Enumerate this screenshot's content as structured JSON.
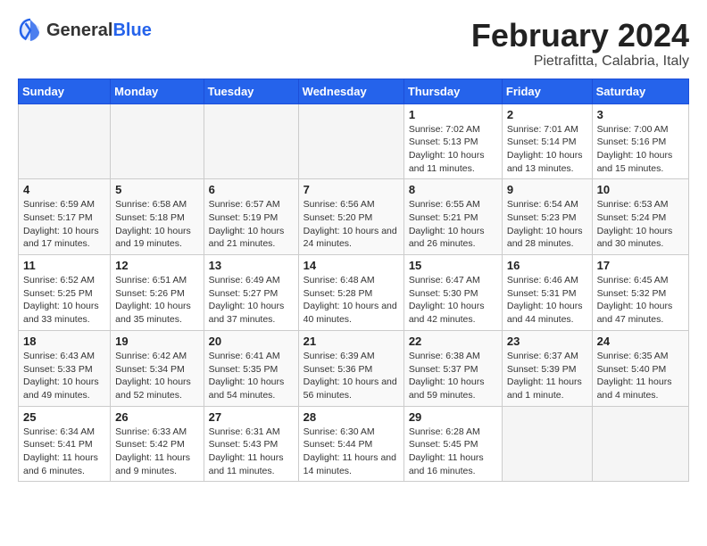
{
  "header": {
    "logo_general": "General",
    "logo_blue": "Blue",
    "main_title": "February 2024",
    "subtitle": "Pietrafitta, Calabria, Italy"
  },
  "calendar": {
    "days_of_week": [
      "Sunday",
      "Monday",
      "Tuesday",
      "Wednesday",
      "Thursday",
      "Friday",
      "Saturday"
    ],
    "weeks": [
      [
        {
          "day": "",
          "info": ""
        },
        {
          "day": "",
          "info": ""
        },
        {
          "day": "",
          "info": ""
        },
        {
          "day": "",
          "info": ""
        },
        {
          "day": "1",
          "info": "Sunrise: 7:02 AM\nSunset: 5:13 PM\nDaylight: 10 hours and 11 minutes."
        },
        {
          "day": "2",
          "info": "Sunrise: 7:01 AM\nSunset: 5:14 PM\nDaylight: 10 hours and 13 minutes."
        },
        {
          "day": "3",
          "info": "Sunrise: 7:00 AM\nSunset: 5:16 PM\nDaylight: 10 hours and 15 minutes."
        }
      ],
      [
        {
          "day": "4",
          "info": "Sunrise: 6:59 AM\nSunset: 5:17 PM\nDaylight: 10 hours and 17 minutes."
        },
        {
          "day": "5",
          "info": "Sunrise: 6:58 AM\nSunset: 5:18 PM\nDaylight: 10 hours and 19 minutes."
        },
        {
          "day": "6",
          "info": "Sunrise: 6:57 AM\nSunset: 5:19 PM\nDaylight: 10 hours and 21 minutes."
        },
        {
          "day": "7",
          "info": "Sunrise: 6:56 AM\nSunset: 5:20 PM\nDaylight: 10 hours and 24 minutes."
        },
        {
          "day": "8",
          "info": "Sunrise: 6:55 AM\nSunset: 5:21 PM\nDaylight: 10 hours and 26 minutes."
        },
        {
          "day": "9",
          "info": "Sunrise: 6:54 AM\nSunset: 5:23 PM\nDaylight: 10 hours and 28 minutes."
        },
        {
          "day": "10",
          "info": "Sunrise: 6:53 AM\nSunset: 5:24 PM\nDaylight: 10 hours and 30 minutes."
        }
      ],
      [
        {
          "day": "11",
          "info": "Sunrise: 6:52 AM\nSunset: 5:25 PM\nDaylight: 10 hours and 33 minutes."
        },
        {
          "day": "12",
          "info": "Sunrise: 6:51 AM\nSunset: 5:26 PM\nDaylight: 10 hours and 35 minutes."
        },
        {
          "day": "13",
          "info": "Sunrise: 6:49 AM\nSunset: 5:27 PM\nDaylight: 10 hours and 37 minutes."
        },
        {
          "day": "14",
          "info": "Sunrise: 6:48 AM\nSunset: 5:28 PM\nDaylight: 10 hours and 40 minutes."
        },
        {
          "day": "15",
          "info": "Sunrise: 6:47 AM\nSunset: 5:30 PM\nDaylight: 10 hours and 42 minutes."
        },
        {
          "day": "16",
          "info": "Sunrise: 6:46 AM\nSunset: 5:31 PM\nDaylight: 10 hours and 44 minutes."
        },
        {
          "day": "17",
          "info": "Sunrise: 6:45 AM\nSunset: 5:32 PM\nDaylight: 10 hours and 47 minutes."
        }
      ],
      [
        {
          "day": "18",
          "info": "Sunrise: 6:43 AM\nSunset: 5:33 PM\nDaylight: 10 hours and 49 minutes."
        },
        {
          "day": "19",
          "info": "Sunrise: 6:42 AM\nSunset: 5:34 PM\nDaylight: 10 hours and 52 minutes."
        },
        {
          "day": "20",
          "info": "Sunrise: 6:41 AM\nSunset: 5:35 PM\nDaylight: 10 hours and 54 minutes."
        },
        {
          "day": "21",
          "info": "Sunrise: 6:39 AM\nSunset: 5:36 PM\nDaylight: 10 hours and 56 minutes."
        },
        {
          "day": "22",
          "info": "Sunrise: 6:38 AM\nSunset: 5:37 PM\nDaylight: 10 hours and 59 minutes."
        },
        {
          "day": "23",
          "info": "Sunrise: 6:37 AM\nSunset: 5:39 PM\nDaylight: 11 hours and 1 minute."
        },
        {
          "day": "24",
          "info": "Sunrise: 6:35 AM\nSunset: 5:40 PM\nDaylight: 11 hours and 4 minutes."
        }
      ],
      [
        {
          "day": "25",
          "info": "Sunrise: 6:34 AM\nSunset: 5:41 PM\nDaylight: 11 hours and 6 minutes."
        },
        {
          "day": "26",
          "info": "Sunrise: 6:33 AM\nSunset: 5:42 PM\nDaylight: 11 hours and 9 minutes."
        },
        {
          "day": "27",
          "info": "Sunrise: 6:31 AM\nSunset: 5:43 PM\nDaylight: 11 hours and 11 minutes."
        },
        {
          "day": "28",
          "info": "Sunrise: 6:30 AM\nSunset: 5:44 PM\nDaylight: 11 hours and 14 minutes."
        },
        {
          "day": "29",
          "info": "Sunrise: 6:28 AM\nSunset: 5:45 PM\nDaylight: 11 hours and 16 minutes."
        },
        {
          "day": "",
          "info": ""
        },
        {
          "day": "",
          "info": ""
        }
      ]
    ]
  }
}
